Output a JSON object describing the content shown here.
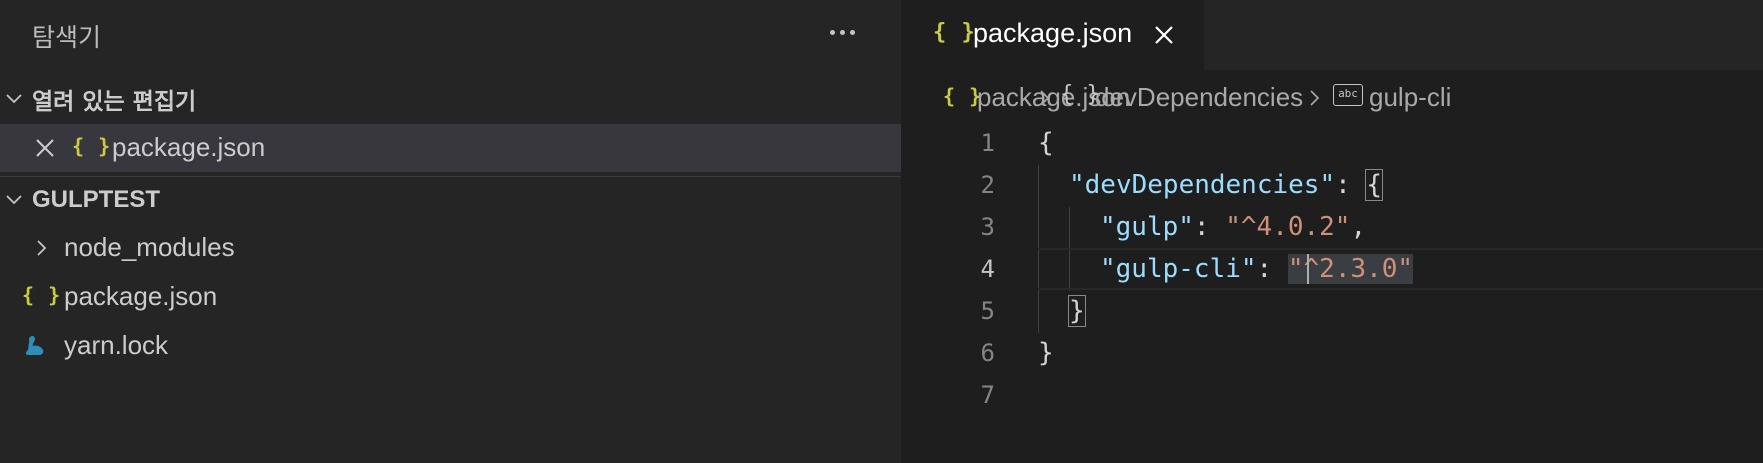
{
  "sidebar": {
    "title": "탐색기",
    "more_icon": "ellipsis-icon",
    "open_editors": {
      "label": "열려 있는 편집기",
      "items": [
        {
          "icon": "{ }",
          "label": "package.json"
        }
      ]
    },
    "project": {
      "label": "GULPTEST",
      "items": [
        {
          "label": "node_modules",
          "type": "folder"
        },
        {
          "icon": "{ }",
          "label": "package.json",
          "type": "json"
        },
        {
          "label": "yarn.lock",
          "type": "yarn"
        }
      ]
    }
  },
  "editor": {
    "tab": {
      "icon": "{ }",
      "label": "package.json"
    },
    "breadcrumb": [
      {
        "icon": "{ }",
        "label": "package.json"
      },
      {
        "icon": "{ }",
        "label": "devDependencies"
      },
      {
        "icon": "abc",
        "label": "gulp-cli"
      }
    ],
    "lines": [
      {
        "n": "1",
        "text": "{"
      },
      {
        "n": "2",
        "key": "\"devDependencies\"",
        "sep": ": ",
        "open": "{"
      },
      {
        "n": "3",
        "key": "\"gulp\"",
        "sep": ": ",
        "val": "\"^4.0.2\"",
        "end": ","
      },
      {
        "n": "4",
        "key": "\"gulp-cli\"",
        "sep": ": ",
        "val": "\"^2.3.0\""
      },
      {
        "n": "5",
        "text": "}"
      },
      {
        "n": "6",
        "text": "}"
      },
      {
        "n": "7",
        "text": ""
      }
    ],
    "active_line": 4
  },
  "colors": {
    "json_icon": "#cbcb41",
    "key": "#9cdcfe",
    "string": "#ce9178",
    "yarn_icon": "#2c8ebb"
  }
}
